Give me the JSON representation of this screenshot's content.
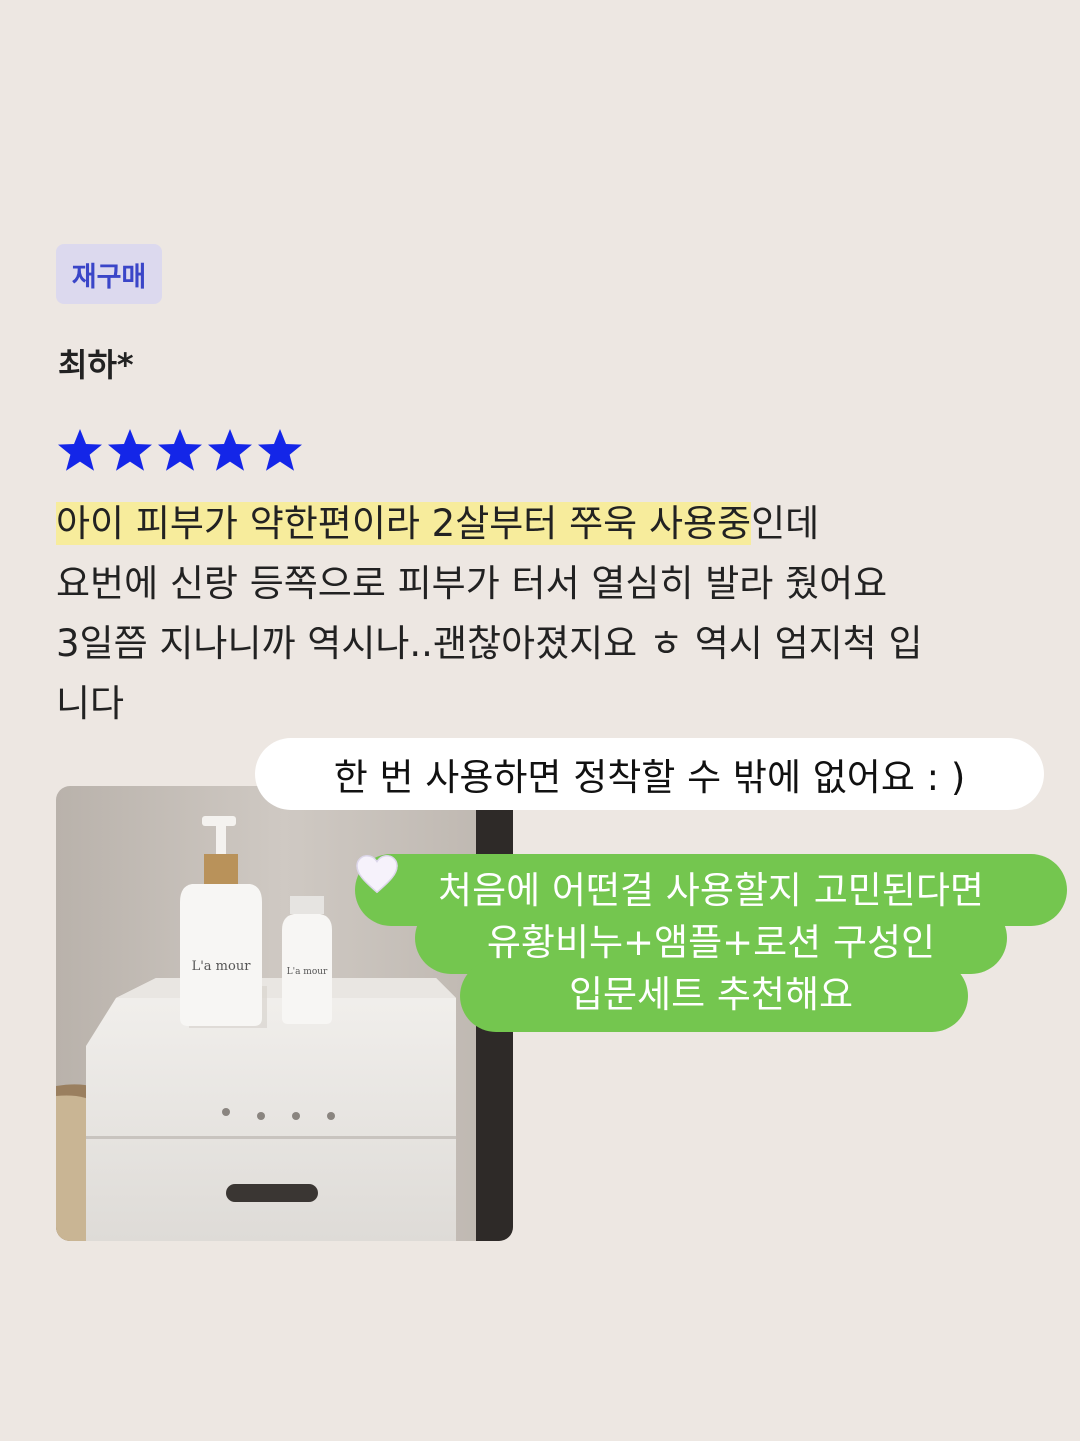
{
  "badge": {
    "label": "재구매"
  },
  "reviewer": {
    "name": "최하*"
  },
  "rating": {
    "stars": 5,
    "max": 5,
    "color": "#1426e8"
  },
  "review": {
    "highlight": "아이 피부가 약한편이라 2살부터 쭈욱 사용중",
    "line1_rest": "인데",
    "line2": "요번에 신랑 등쪽으로 피부가 터서 열심히 발라 줬어요",
    "line3": "3일쯤 지나니까 역시나..괜찮아졌지요 ㅎ 역시 엄지척 입",
    "line4": "니다"
  },
  "callout_white": {
    "text": "한 번 사용하면 정착할 수 밖에 없어요 : )"
  },
  "callout_green": {
    "line1": "처음에 어떤걸 사용할지 고민된다면",
    "line2": "유황비누+앰플+로션 구성인",
    "line3": "입문세트 추천해요",
    "color": "#74c64f"
  },
  "photo": {
    "bottle_brand": "L'a mour",
    "small_bottle_brand": "L'a mour"
  }
}
